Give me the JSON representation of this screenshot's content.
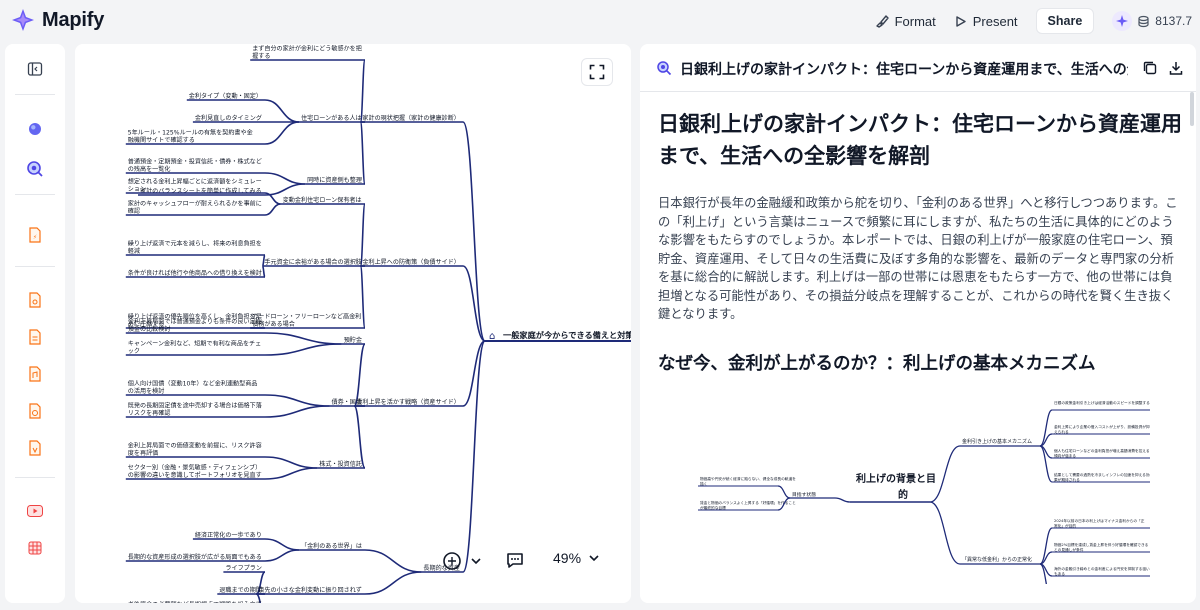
{
  "app": {
    "name": "Mapify",
    "brand_color": "#6b5cf6"
  },
  "topbar": {
    "format_label": "Format",
    "present_label": "Present",
    "share_label": "Share",
    "credits": "8137.7"
  },
  "rail": {
    "icons": [
      "sidebar-toggle-icon",
      "dot-icon",
      "search-doc-icon",
      "file-icon",
      "pdf-icon",
      "doc-icon",
      "audio-file-icon",
      "web-file-icon",
      "file-icon",
      "youtube-icon",
      "video-icon"
    ]
  },
  "mindmap": {
    "root": "一般家庭が今からできる備えと対策",
    "branch_color": "#1e2a78",
    "zoom": "49%",
    "branches": [
      {
        "label": "家計の現状把握（家計の健康診断）",
        "children": [
          {
            "label": "まず自分の家計が金利にどう敏感かを把握する",
            "children": []
          },
          {
            "label": "住宅ローンがある人は",
            "children": [
              "金利タイプ（変動・固定）",
              "金利見直しのタイミング",
              "5年ルール・125%ルールの有無を契約書や金融機関サイトで確認する"
            ]
          },
          {
            "label": "同時に資産側も整理",
            "children": [
              "普通預金・定期預金・投資信託・債券・株式などの残高を一覧化",
              "家計のバランスシートを簡単に作成してみる"
            ]
          }
        ]
      },
      {
        "label": "金利上昇への防衛策（負債サイド）",
        "children": [
          {
            "label": "変動金利住宅ローン保有者は",
            "children": [
              "想定される金利上昇幅ごとに返済額をシミュレーション",
              "家計のキャッシュフローが耐えられるかを事前に確認"
            ]
          },
          {
            "label": "手元資金に余裕がある場合の選択肢",
            "children": [
              "繰り上げ返済で元本を減らし、将来の利息負担を軽減",
              "条件が良ければ他行や他商品への借り換えを検討"
            ]
          },
          {
            "label": "カードローン・フリーローンなど高金利債務がある場合",
            "children": [
              "繰り上げ返済の優先順位を高くし、金利負担を早めに圧縮する"
            ]
          }
        ]
      },
      {
        "label": "金利上昇を活かす戦略（資産サイド）",
        "children": [
          {
            "label": "預貯金",
            "children": [
              "金利上昇局面では普通預金よりも条件の良い定期預金の比較検討",
              "キャンペーン金利など、短期で有利な商品をチェック"
            ]
          },
          {
            "label": "債券・国債",
            "children": [
              "個人向け国債（変動10年）など金利連動型商品の活用を検討",
              "既発の長期固定債を途中売却する場合は価格下落リスクを再確認"
            ]
          },
          {
            "label": "株式・投資信託",
            "children": [
              "金利上昇局面での価値変動を前提に、リスク許容度を再評価",
              "セクター別（金融・景気敏感・ディフェンシブ）の影響の違いを意識してポートフォリオを見直す"
            ]
          }
        ]
      },
      {
        "label": "長期的な資産",
        "children": [
          {
            "label": "「金利のある世界」は",
            "children": [
              "経済正常化の一歩であり",
              "長期的な資産形成の選択肢が広がる局面でもある"
            ]
          },
          {
            "label": "目先の小さな金利変動に振り回されず",
            "children": [
              "ライフプラン",
              "退職までの期間",
              "老後資金の必要額など長期視点で戦略を組み立てることが重要"
            ]
          }
        ]
      }
    ]
  },
  "document": {
    "header_title": "日銀利上げの家計インパクト：住宅ローンから資産運用まで、生活への全影響...",
    "title": "日銀利上げの家計インパクト：住宅ローンから資産運用まで、生活への全影響を解剖",
    "intro": "日本銀行が長年の金融緩和政策から舵を切り、「金利のある世界」へと移行しつつあります。この「利上げ」という言葉はニュースで頻繁に耳にしますが、私たちの生活に具体的にどのような影響をもたらすのでしょうか。本レポートでは、日銀の利上げが一般家庭の住宅ローン、預貯金、資産運用、そして日々の生活費に及ぼす多角的な影響を、最新のデータと専門家の分析を基に総合的に解説します。利上げは一部の世帯には恩恵をもたらす一方で、他の世帯には負担増となる可能性があり、その損益分岐点を理解することが、これからの時代を賢く生き抜く鍵となります。",
    "section_title": "なぜ今、金利が上がるのか？：利上げの基本メカニズム"
  },
  "embedded_map": {
    "root": "利上げの背景と目的",
    "branches": [
      {
        "label": "金利引き上げの基本メカニズム",
        "children": [
          "日銀の政策金利引き上げは経済活動のスピードを調整する",
          "金利上昇により企業の借入コストが上がり、設備投資が抑えられる",
          "個人も住宅ローンなどの金利負担が増え高額消費を控える傾向が強まる",
          "結果として需要の過熱を冷ましインフレの加速を抑える効果が期待される"
        ]
      },
      {
        "label": "目指す状態",
        "children": [
          "物価高や円安が続く経済に陥らない、健全な成長の軌道を描く",
          "賃金と物価のバランスよく上昇する「好循環」を作ることが最終的な目標"
        ]
      },
      {
        "label": "「異常な低金利」からの正常化",
        "children": [
          "2024年以前の日本の利上げはマイナス金利からの「正常化」が目的",
          "物価2%目標を達成し賃金上昇を伴う好循環を確認できるとの見通しが条件",
          "海外の金融引き締めとの金利差による円安を抑制する狙いもある",
          "過度な「緩和的な金融環境」は維持されるとの見方が大勢"
        ]
      }
    ]
  }
}
